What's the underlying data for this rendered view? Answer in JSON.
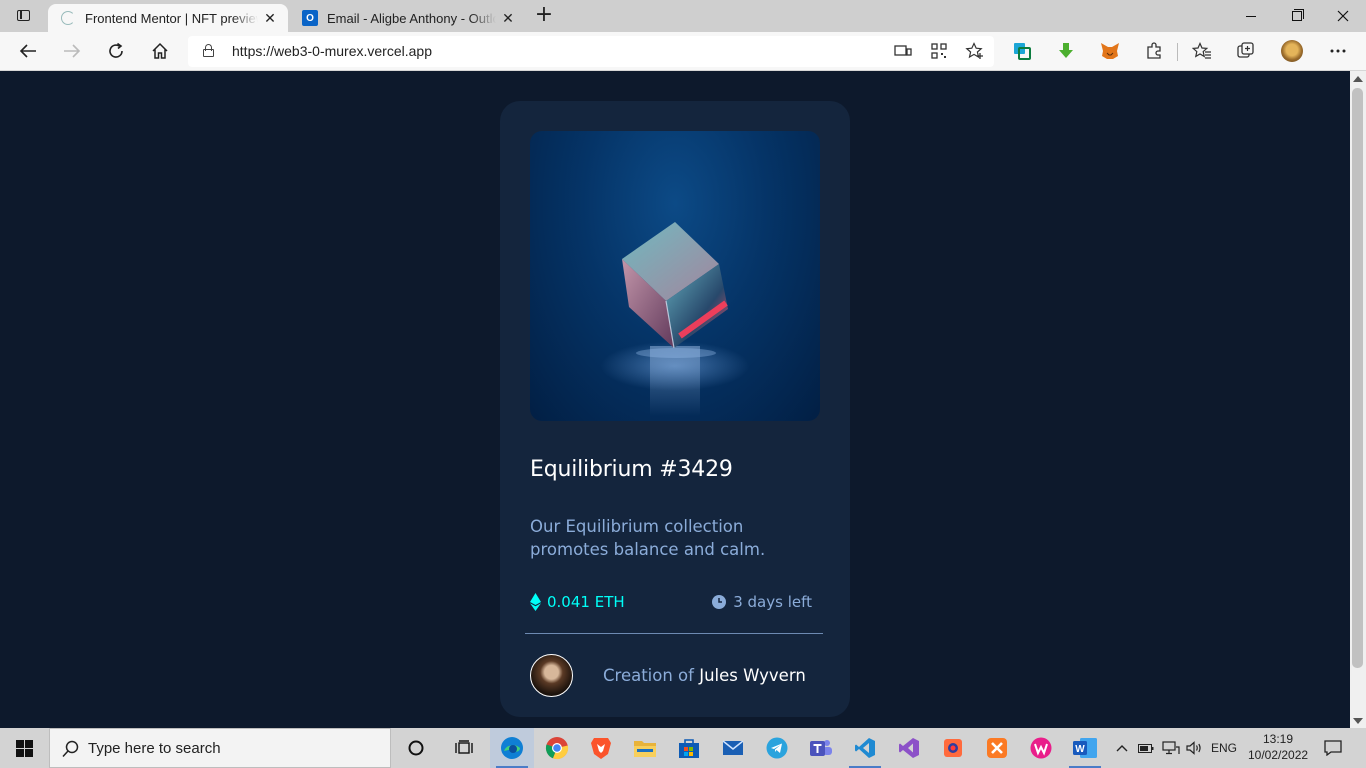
{
  "browser": {
    "tabs": [
      {
        "title": "Frontend Mentor | NFT preview c",
        "active": true,
        "icon": "frontend-mentor-favicon"
      },
      {
        "title": "Email - Aligbe Anthony - Outlook",
        "active": false,
        "icon": "outlook-favicon"
      }
    ],
    "url": "https://web3-0-murex.vercel.app",
    "outlook_letter": "O"
  },
  "card": {
    "title": "Equilibrium #3429",
    "description": "Our Equilibrium collection promotes balance and calm.",
    "price": "0.041 ETH",
    "time_left": "3 days left",
    "creator_prefix": "Creation of",
    "creator_name": "Jules Wyvern",
    "colors": {
      "accent": "#00fff8",
      "soft_blue": "#8bacd9",
      "card_bg": "#14253d",
      "page_bg": "#0d192c"
    }
  },
  "taskbar": {
    "search_placeholder": "Type here to search",
    "language": "ENG",
    "time": "13:19",
    "date": "10/02/2022",
    "word_letter": "W"
  }
}
